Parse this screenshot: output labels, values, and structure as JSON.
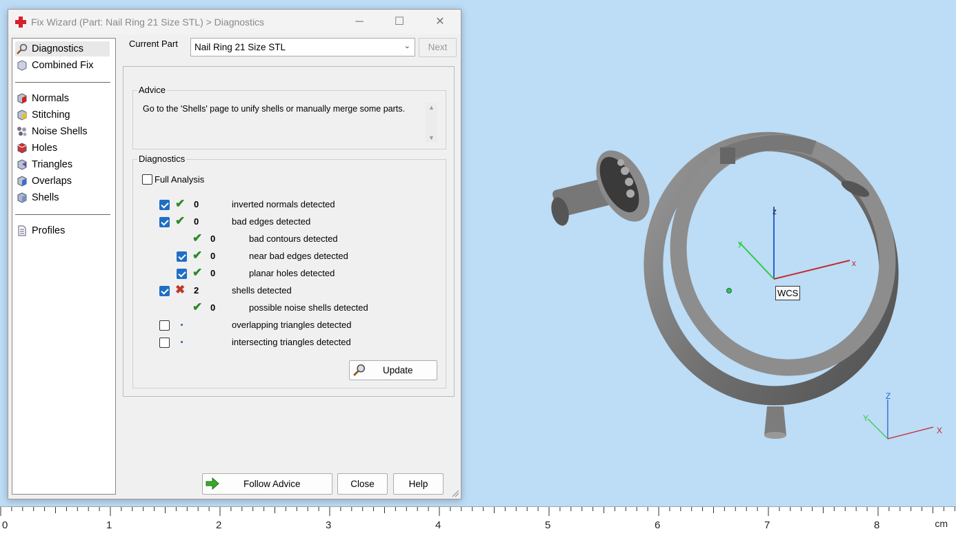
{
  "window": {
    "title": "Fix Wizard (Part: Nail Ring 21 Size STL) > Diagnostics",
    "minimize": "─",
    "maximize": "☐",
    "close": "✕"
  },
  "nav": {
    "items": [
      {
        "label": "Diagnostics"
      },
      {
        "label": "Combined Fix"
      },
      {
        "label": "Normals"
      },
      {
        "label": "Stitching"
      },
      {
        "label": "Noise Shells"
      },
      {
        "label": "Holes"
      },
      {
        "label": "Triangles"
      },
      {
        "label": "Overlaps"
      },
      {
        "label": "Shells"
      },
      {
        "label": "Profiles"
      }
    ]
  },
  "header": {
    "current_part_label": "Current Part",
    "current_part_value": "Nail Ring 21 Size STL",
    "next_label": "Next"
  },
  "advice": {
    "title": "Advice",
    "text": "Go to the 'Shells' page to unify shells or manually merge some parts."
  },
  "diagnostics": {
    "title": "Diagnostics",
    "full_analysis_label": "Full Analysis",
    "rows": [
      {
        "count": "0",
        "text": "inverted normals detected"
      },
      {
        "count": "0",
        "text": "bad edges detected"
      },
      {
        "count": "0",
        "text": "bad contours detected"
      },
      {
        "count": "0",
        "text": "near bad edges detected"
      },
      {
        "count": "0",
        "text": "planar holes detected"
      },
      {
        "count": "2",
        "text": "shells detected"
      },
      {
        "count": "0",
        "text": "possible noise shells detected"
      },
      {
        "count": "",
        "text": "overlapping triangles detected"
      },
      {
        "count": "",
        "text": "intersecting triangles detected"
      }
    ],
    "update_label": "Update"
  },
  "footer": {
    "follow_advice_label": "Follow Advice",
    "close_label": "Close",
    "help_label": "Help"
  },
  "viewport": {
    "wcs_label": "WCS",
    "axis_x": "x",
    "axis_y": "y",
    "axis_z": "z",
    "mini_x": "X",
    "mini_y": "Y",
    "mini_z": "Z"
  },
  "ruler": {
    "ticks": [
      "0",
      "1",
      "2",
      "3",
      "4",
      "5",
      "6",
      "7",
      "8"
    ],
    "unit": "cm"
  },
  "colors": {
    "viewport_bg": "#bddcf5",
    "selection_blue": "#1e6fc5",
    "check_green": "#2a8a2a",
    "cross_red": "#c0392b"
  }
}
